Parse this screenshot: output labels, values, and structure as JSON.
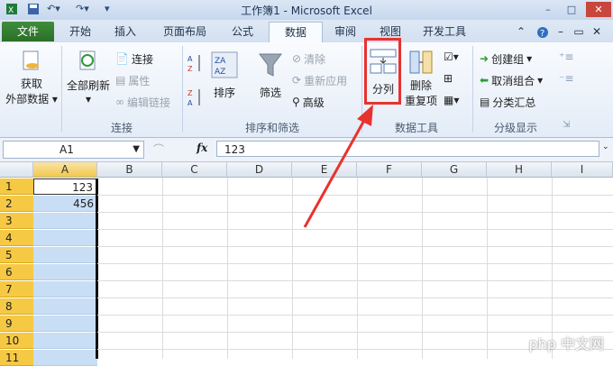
{
  "window": {
    "title": "工作簿1 - Microsoft Excel",
    "controls": [
      "–",
      "□",
      "✕"
    ]
  },
  "tabs": [
    {
      "label": "文件"
    },
    {
      "label": "开始"
    },
    {
      "label": "插入"
    },
    {
      "label": "页面布局"
    },
    {
      "label": "公式"
    },
    {
      "label": "数据"
    },
    {
      "label": "审阅"
    },
    {
      "label": "视图"
    },
    {
      "label": "开发工具"
    }
  ],
  "ribbon": {
    "get_external": {
      "line1": "获取",
      "line2": "外部数据"
    },
    "refresh_all": "全部刷新",
    "connections": {
      "connect": "连接",
      "properties": "属性",
      "edit_links": "编辑链接",
      "group": "连接"
    },
    "sort_filter": {
      "sort": "排序",
      "filter": "筛选",
      "clear": "清除",
      "reapply": "重新应用",
      "advanced": "高级",
      "group": "排序和筛选"
    },
    "data_tools": {
      "text_to_columns": "分列",
      "remove_dup_1": "删除",
      "remove_dup_2": "重复项",
      "group": "数据工具"
    },
    "outline": {
      "group_btn": "创建组",
      "ungroup": "取消组合",
      "subtotal": "分类汇总",
      "group": "分级显示"
    }
  },
  "formula_bar": {
    "name_box": "A1",
    "fx": "fx",
    "value": "123"
  },
  "columns": [
    "A",
    "B",
    "C",
    "D",
    "E",
    "F",
    "G",
    "H",
    "I"
  ],
  "rows": [
    "1",
    "2",
    "3",
    "4",
    "5",
    "6",
    "7",
    "8",
    "9",
    "10",
    "11"
  ],
  "cells": {
    "A1": "123",
    "A2": "456"
  },
  "watermark": "php 中文网",
  "colors": {
    "accent_file_tab": "#2b6e28",
    "selection_header": "#f6c945",
    "selection_fill": "#c8def5",
    "annotation": "#e8322e"
  }
}
